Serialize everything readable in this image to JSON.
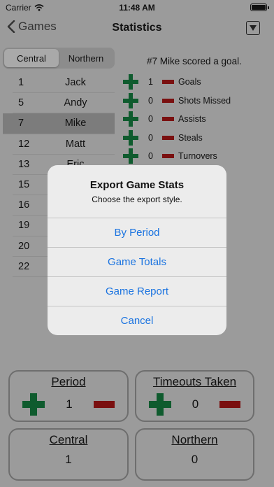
{
  "status_bar": {
    "carrier": "Carrier",
    "time": "11:48 AM"
  },
  "nav": {
    "back_label": "Games",
    "title": "Statistics"
  },
  "teams": {
    "segments": [
      "Central",
      "Northern"
    ],
    "selected": "Central"
  },
  "roster": [
    {
      "num": "1",
      "name": "Jack"
    },
    {
      "num": "5",
      "name": "Andy"
    },
    {
      "num": "7",
      "name": "Mike",
      "selected": true
    },
    {
      "num": "12",
      "name": "Matt"
    },
    {
      "num": "13",
      "name": "Eric"
    },
    {
      "num": "15",
      "name": ""
    },
    {
      "num": "16",
      "name": ""
    },
    {
      "num": "19",
      "name": ""
    },
    {
      "num": "20",
      "name": ""
    },
    {
      "num": "22",
      "name": ""
    }
  ],
  "announcement": "#7 Mike scored a goal.",
  "stats": [
    {
      "value": "1",
      "label": "Goals"
    },
    {
      "value": "0",
      "label": "Shots Missed"
    },
    {
      "value": "0",
      "label": "Assists"
    },
    {
      "value": "0",
      "label": "Steals"
    },
    {
      "value": "0",
      "label": "Turnovers"
    }
  ],
  "period": {
    "title": "Period",
    "value": "1"
  },
  "timeouts": {
    "title": "Timeouts Taken",
    "value": "0"
  },
  "scores": [
    {
      "team": "Central",
      "score": "1"
    },
    {
      "team": "Northern",
      "score": "0"
    }
  ],
  "alert": {
    "title": "Export Game Stats",
    "message": "Choose the export style.",
    "buttons": [
      "By Period",
      "Game Totals",
      "Game Report",
      "Cancel"
    ]
  },
  "colors": {
    "accent": "#1a73e0",
    "plus_green": "#0f5b2e",
    "minus_red": "#7a1010"
  }
}
